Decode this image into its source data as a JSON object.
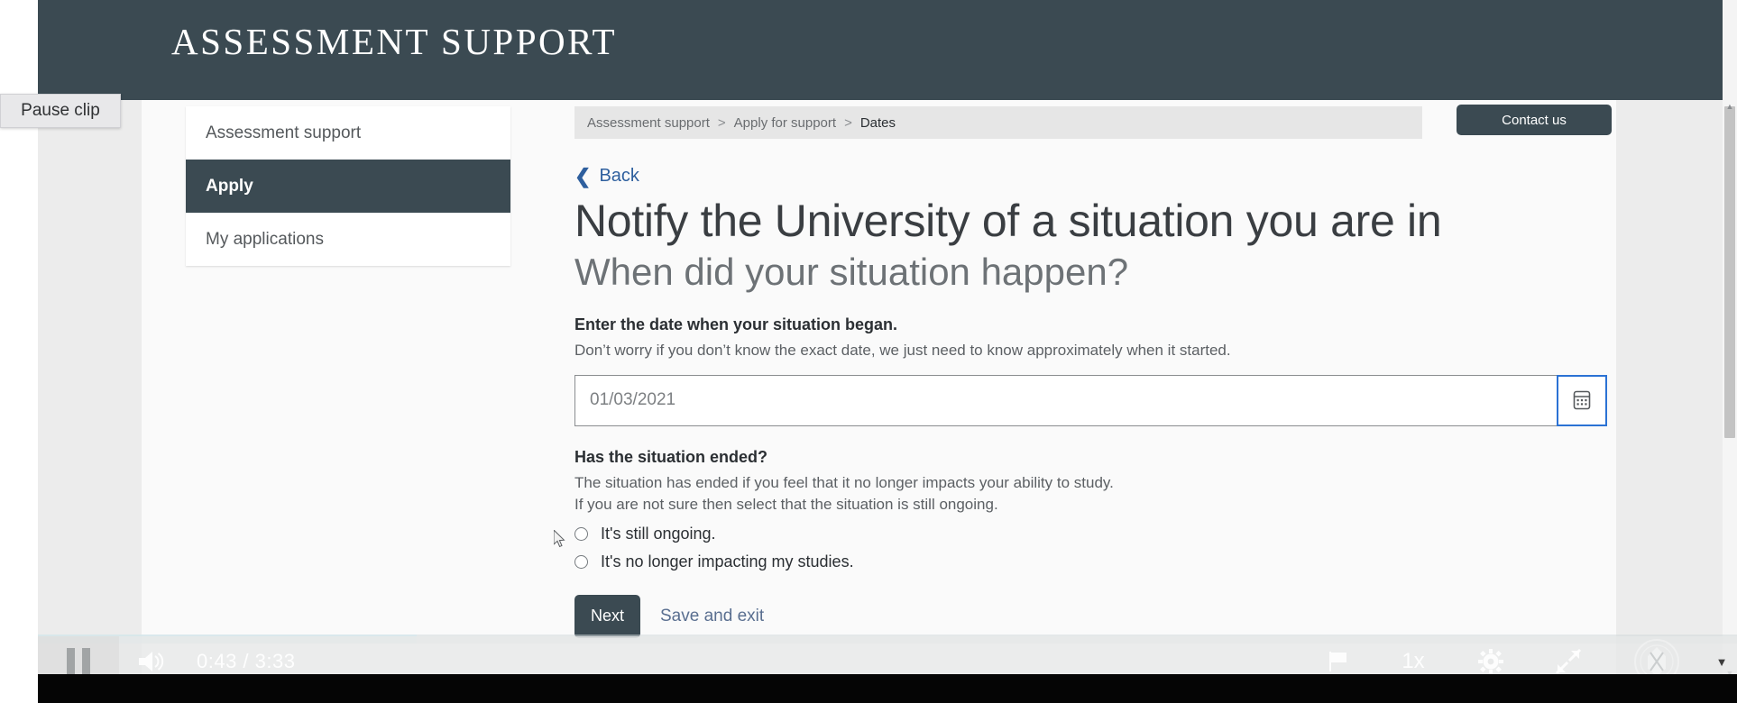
{
  "tooltip": {
    "label": "Pause clip"
  },
  "site": {
    "banner_title": "ASSESSMENT SUPPORT",
    "brand_dark": "#3b4a52",
    "link_blue": "#2e5f9e"
  },
  "sidebar": {
    "items": [
      {
        "label": "Assessment support",
        "active": false
      },
      {
        "label": "Apply",
        "active": true
      },
      {
        "label": "My applications",
        "active": false
      }
    ]
  },
  "breadcrumb": {
    "items": [
      "Assessment support",
      "Apply for support",
      "Dates"
    ],
    "separator": ">"
  },
  "header_actions": {
    "contact_label": "Contact us"
  },
  "main": {
    "back_label": "Back",
    "back_icon": "chevron-left-icon",
    "title": "Notify the University of a situation you are in",
    "subtitle": "When did your situation happen?",
    "date_field": {
      "label": "Enter the date when your situation began.",
      "help": "Don’t worry if you don’t know the exact date, we just need to know approximately when it started.",
      "value": "01/03/2021",
      "picker_icon": "calendar-icon"
    },
    "ended_field": {
      "label": "Has the situation ended?",
      "help_line1": "The situation has ended if you feel that it no longer impacts your ability to study.",
      "help_line2": "If you are not sure then select that the situation is still ongoing.",
      "options": [
        {
          "label": "It's still ongoing.",
          "selected": false
        },
        {
          "label": "It's no longer impacting my studies.",
          "selected": false
        }
      ]
    },
    "actions": {
      "next_label": "Next",
      "save_exit_label": "Save and exit"
    }
  },
  "player": {
    "pause_icon": "pause-icon",
    "volume_icon": "volume-icon",
    "current_time": "0:43",
    "time_separator": "/",
    "duration": "3:33",
    "time_display": "0:43  /  3:33",
    "chapters_icon": "flag-icon",
    "speed_label": "1x",
    "settings_icon": "gear-icon",
    "fullscreen_icon": "fullscreen-icon",
    "logo_icon": "university-crest-icon",
    "caret_icon": "caret-down-icon"
  },
  "scrollbar": {
    "up_icon": "caret-up-icon",
    "down_icon": "caret-down-icon"
  }
}
